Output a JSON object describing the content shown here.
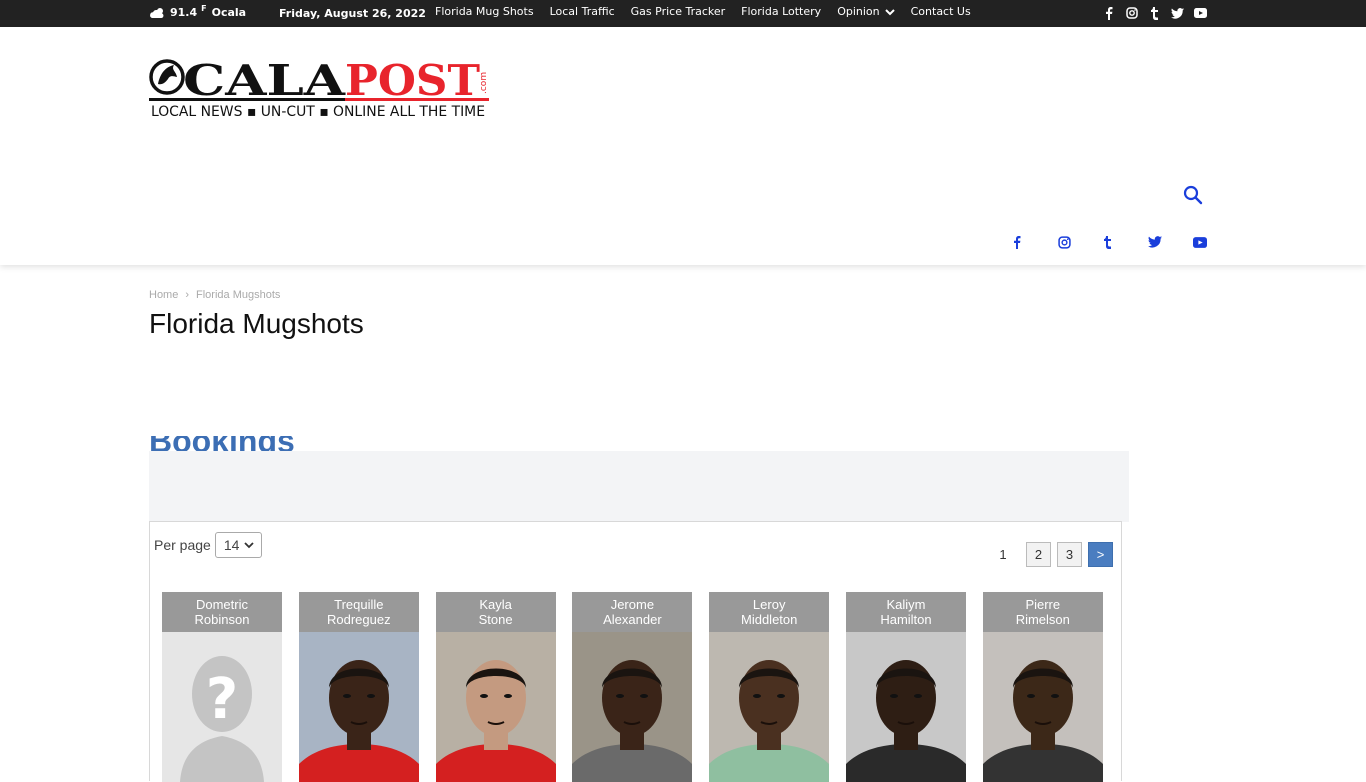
{
  "topbar": {
    "temperature": "91.4",
    "unit": "F",
    "city": "Ocala",
    "date": "Friday, August 26, 2022",
    "nav": [
      {
        "label": "Florida Mug Shots"
      },
      {
        "label": "Local Traffic"
      },
      {
        "label": "Gas Price Tracker"
      },
      {
        "label": "Florida Lottery"
      },
      {
        "label": "Opinion"
      },
      {
        "label": "Contact Us"
      }
    ],
    "social_icons": [
      "facebook-icon",
      "instagram-icon",
      "tumblr-icon",
      "twitter-icon",
      "youtube-icon"
    ]
  },
  "logo": {
    "part1": "OCALA",
    "part2": "POST",
    "suffix": ".com",
    "tagline": "LOCAL NEWS  ▪  UN-CUT  ▪  ONLINE ALL THE TIME"
  },
  "header": {
    "search_icon": "search-icon",
    "social_icons": [
      "facebook-icon",
      "instagram-icon",
      "tumblr-icon",
      "twitter-icon",
      "youtube-icon"
    ]
  },
  "breadcrumb": {
    "home": "Home",
    "current": "Florida Mugshots"
  },
  "page": {
    "title": "Florida Mugshots"
  },
  "bookings": {
    "heading_peek": "Bookings",
    "per_page_label": "Per page",
    "per_page_value": "14",
    "pager": {
      "current": "1",
      "pages": [
        "2",
        "3"
      ],
      "next": ">"
    },
    "mugshots": [
      {
        "first": "Dometric",
        "last": "Robinson",
        "placeholder": true
      },
      {
        "first": "Trequille",
        "last": "Rodreguez",
        "bg": "#a8b4c4",
        "skin": "#3a2418",
        "shirt": "#d42020"
      },
      {
        "first": "Kayla",
        "last": "Stone",
        "bg": "#b8b0a4",
        "skin": "#c49a80",
        "shirt": "#d42020"
      },
      {
        "first": "Jerome",
        "last": "Alexander",
        "bg": "#9a9488",
        "skin": "#3a2418",
        "shirt": "#6a6a6a"
      },
      {
        "first": "Leroy",
        "last": "Middleton",
        "bg": "#bdb8b0",
        "skin": "#4a3020",
        "shirt": "#8fbfa0"
      },
      {
        "first": "Kaliym",
        "last": "Hamilton",
        "bg": "#c8c8c8",
        "skin": "#2e1e14",
        "shirt": "#2a2a2a"
      },
      {
        "first": "Pierre",
        "last": "Rimelson",
        "bg": "#c4c0bc",
        "skin": "#3c2818",
        "shirt": "#333333"
      }
    ]
  },
  "colors": {
    "topbar_bg": "#222222",
    "logo_red": "#e8242c",
    "accent_blue": "#3c6eb4",
    "social_blue": "#1a3edb"
  }
}
